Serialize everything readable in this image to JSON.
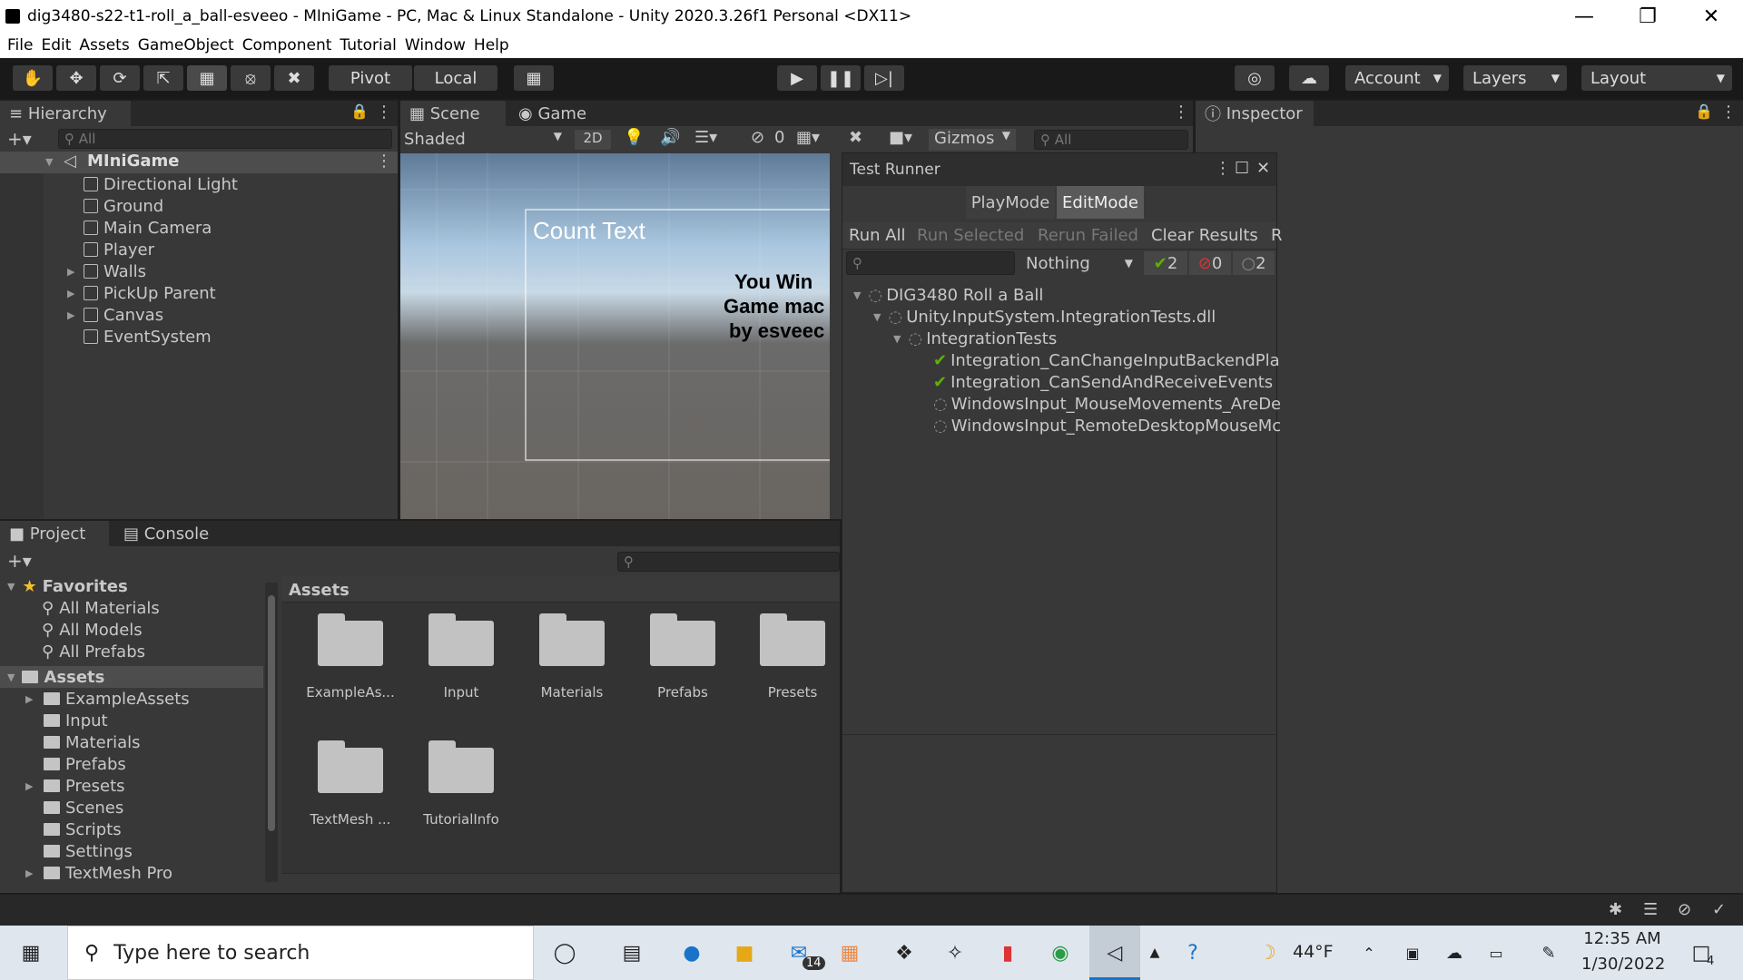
{
  "window": {
    "title": "dig3480-s22-t1-roll_a_ball-esveeo - MIniGame - PC, Mac & Linux Standalone - Unity 2020.3.26f1 Personal <DX11>"
  },
  "menu": [
    "File",
    "Edit",
    "Assets",
    "GameObject",
    "Component",
    "Tutorial",
    "Window",
    "Help"
  ],
  "toolbar": {
    "pivot": "Pivot",
    "local": "Local",
    "account": "Account",
    "layers": "Layers",
    "layout": "Layout"
  },
  "hierarchy": {
    "tab": "Hierarchy",
    "search": "All",
    "scene": "MIniGame",
    "items": [
      "Directional Light",
      "Ground",
      "Main Camera",
      "Player",
      "Walls",
      "PickUp Parent",
      "Canvas",
      "EventSystem"
    ]
  },
  "scene": {
    "tab_scene": "Scene",
    "tab_game": "Game",
    "shading": "Shaded",
    "mode2d": "2D",
    "hidden_count": "0",
    "gizmos": "Gizmos",
    "search": "All",
    "count_text": "Count Text",
    "win_lines": [
      "You Win",
      "Game mac",
      "by esveec"
    ]
  },
  "inspector": {
    "tab": "Inspector"
  },
  "test_runner": {
    "title": "Test Runner",
    "tab_play": "PlayMode",
    "tab_edit": "EditMode",
    "actions": [
      "Run All",
      "Run Selected",
      "Rerun Failed",
      "Clear Results",
      "R"
    ],
    "filter": "Nothing",
    "passed": "2",
    "failed": "0",
    "skipped": "2",
    "tree": [
      {
        "label": "DIG3480 Roll a Ball",
        "status": "none"
      },
      {
        "label": "Unity.InputSystem.IntegrationTests.dll",
        "status": "none"
      },
      {
        "label": "IntegrationTests",
        "status": "none"
      },
      {
        "label": "Integration_CanChangeInputBackendPla",
        "status": "pass"
      },
      {
        "label": "Integration_CanSendAndReceiveEvents",
        "status": "pass"
      },
      {
        "label": "WindowsInput_MouseMovements_AreDe",
        "status": "none"
      },
      {
        "label": "WindowsInput_RemoteDesktopMouseMc",
        "status": "none"
      }
    ]
  },
  "project": {
    "tab_project": "Project",
    "tab_console": "Console",
    "favorites": "Favorites",
    "fav_items": [
      "All Materials",
      "All Models",
      "All Prefabs"
    ],
    "assets": "Assets",
    "asset_items": [
      "ExampleAssets",
      "Input",
      "Materials",
      "Prefabs",
      "Presets",
      "Scenes",
      "Scripts",
      "Settings",
      "TextMesh Pro"
    ],
    "grid_title": "Assets",
    "grid": [
      "ExampleAs...",
      "Input",
      "Materials",
      "Prefabs",
      "Presets",
      "TextMesh ...",
      "TutorialInfo"
    ]
  },
  "taskbar": {
    "search": "Type here to search",
    "mail_badge": "14",
    "temp": "44°F",
    "time": "12:35 AM",
    "date": "1/30/2022",
    "notif": "4"
  },
  "colors": {
    "accent": "#2c5d87",
    "pass": "#59b300",
    "fail": "#d33"
  }
}
